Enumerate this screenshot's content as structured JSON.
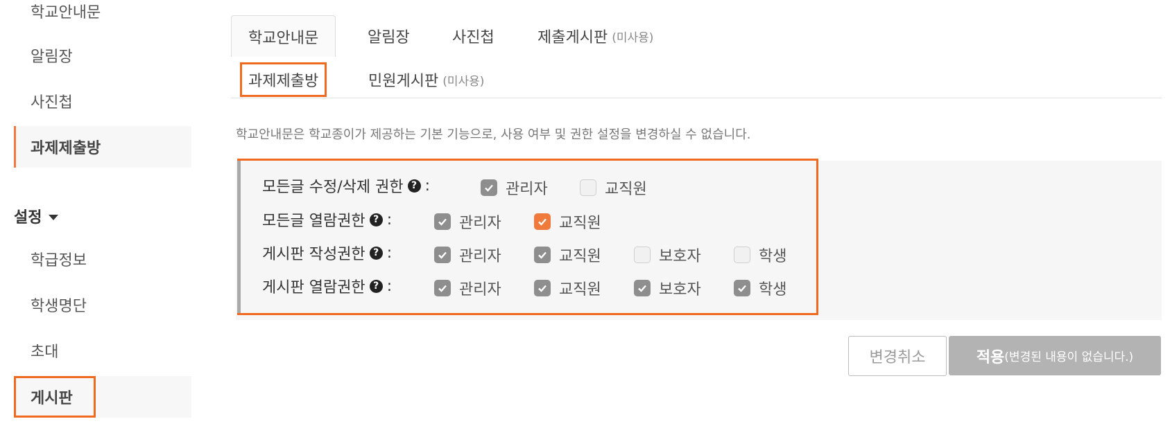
{
  "sidebar": {
    "items": [
      {
        "label": "학교안내문"
      },
      {
        "label": "알림장"
      },
      {
        "label": "사진첩"
      },
      {
        "label": "과제제출방"
      }
    ],
    "settings_heading": "설정",
    "settings_items": [
      {
        "label": "학급정보"
      },
      {
        "label": "학생명단"
      },
      {
        "label": "초대"
      },
      {
        "label": "게시판"
      }
    ]
  },
  "tabs": {
    "row1": [
      {
        "label": "학교안내문",
        "note": ""
      },
      {
        "label": "알림장",
        "note": ""
      },
      {
        "label": "사진첩",
        "note": ""
      },
      {
        "label": "제출게시판",
        "note": "(미사용)"
      }
    ],
    "row2": [
      {
        "label": "과제제출방",
        "note": ""
      },
      {
        "label": "민원게시판",
        "note": "(미사용)"
      }
    ]
  },
  "notice": "학교안내문은 학교종이가 제공하는 기본 기능으로, 사용 여부 및 권한 설정을 변경하실 수 없습니다.",
  "permissions": {
    "help_glyph": "?",
    "colon": ":",
    "rows": [
      {
        "label": "모든글 수정/삭제 권한",
        "options": [
          {
            "label": "관리자",
            "state": "checked"
          },
          {
            "label": "교직원",
            "state": "unchecked"
          }
        ]
      },
      {
        "label": "모든글 열람권한",
        "options": [
          {
            "label": "관리자",
            "state": "checked"
          },
          {
            "label": "교직원",
            "state": "checked-accent"
          }
        ]
      },
      {
        "label": "게시판 작성권한",
        "options": [
          {
            "label": "관리자",
            "state": "checked"
          },
          {
            "label": "교직원",
            "state": "checked"
          },
          {
            "label": "보호자",
            "state": "unchecked"
          },
          {
            "label": "학생",
            "state": "unchecked"
          }
        ]
      },
      {
        "label": "게시판 열람권한",
        "options": [
          {
            "label": "관리자",
            "state": "checked"
          },
          {
            "label": "교직원",
            "state": "checked"
          },
          {
            "label": "보호자",
            "state": "checked"
          },
          {
            "label": "학생",
            "state": "checked"
          }
        ]
      }
    ]
  },
  "buttons": {
    "cancel": "변경취소",
    "apply": "적용",
    "apply_note": "(변경된 내용이 없습니다.)"
  },
  "colors": {
    "accent": "#f07a3c",
    "highlight": "#ef6a1f",
    "checked": "#8e8e8e"
  }
}
